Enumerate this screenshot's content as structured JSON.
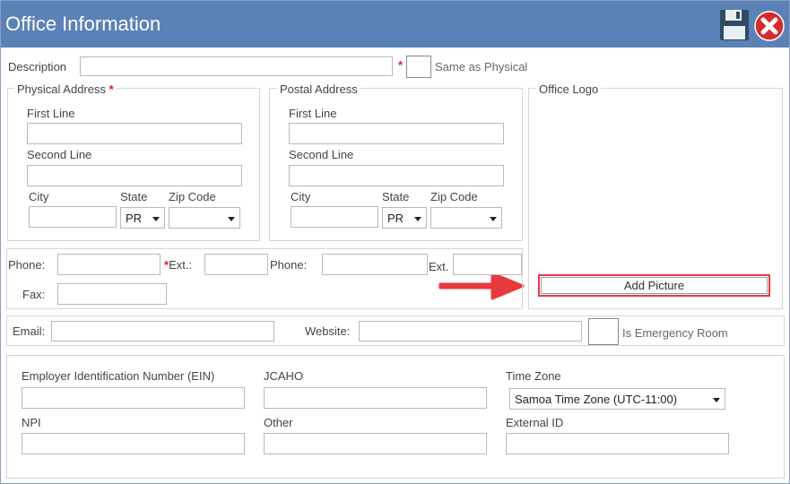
{
  "window": {
    "title": "Office Information"
  },
  "toolbar": {
    "save_icon": "floppy-disk-icon",
    "close_icon": "red-close-icon"
  },
  "description": {
    "label": "Description",
    "value": "",
    "required_mark": "*",
    "same_as_physical_label": "Same as Physical"
  },
  "physical_address": {
    "legend": "Physical Address",
    "required_mark": "*",
    "first_line_label": "First Line",
    "second_line_label": "Second Line",
    "city_label": "City",
    "state_label": "State",
    "state_value": "PR",
    "zip_label": "Zip Code",
    "zip_value": ""
  },
  "postal_address": {
    "legend": "Postal Address",
    "first_line_label": "First Line",
    "second_line_label": "Second Line",
    "city_label": "City",
    "state_label": "State",
    "state_value": "PR",
    "zip_label": "Zip Code",
    "zip_value": ""
  },
  "office_logo": {
    "legend": "Office Logo",
    "add_picture_label": "Add Picture"
  },
  "contact": {
    "phone1_label": "Phone:",
    "required_mark": "*",
    "ext1_label": "Ext.:",
    "phone2_label": "Phone:",
    "ext2_label": "Ext.",
    "fax_label": "Fax:"
  },
  "email_row": {
    "email_label": "Email:",
    "website_label": "Website:",
    "emergency_label": "Is Emergency Room"
  },
  "ids": {
    "ein_label": "Employer Identification Number (EIN)",
    "jcaho_label": "JCAHO",
    "timezone_label": "Time Zone",
    "timezone_value": "Samoa Time Zone (UTC-11:00)",
    "npi_label": "NPI",
    "other_label": "Other",
    "external_id_label": "External ID"
  },
  "annotation": {
    "arrow_color": "#e8393f",
    "highlight_color": "#e8393f"
  }
}
